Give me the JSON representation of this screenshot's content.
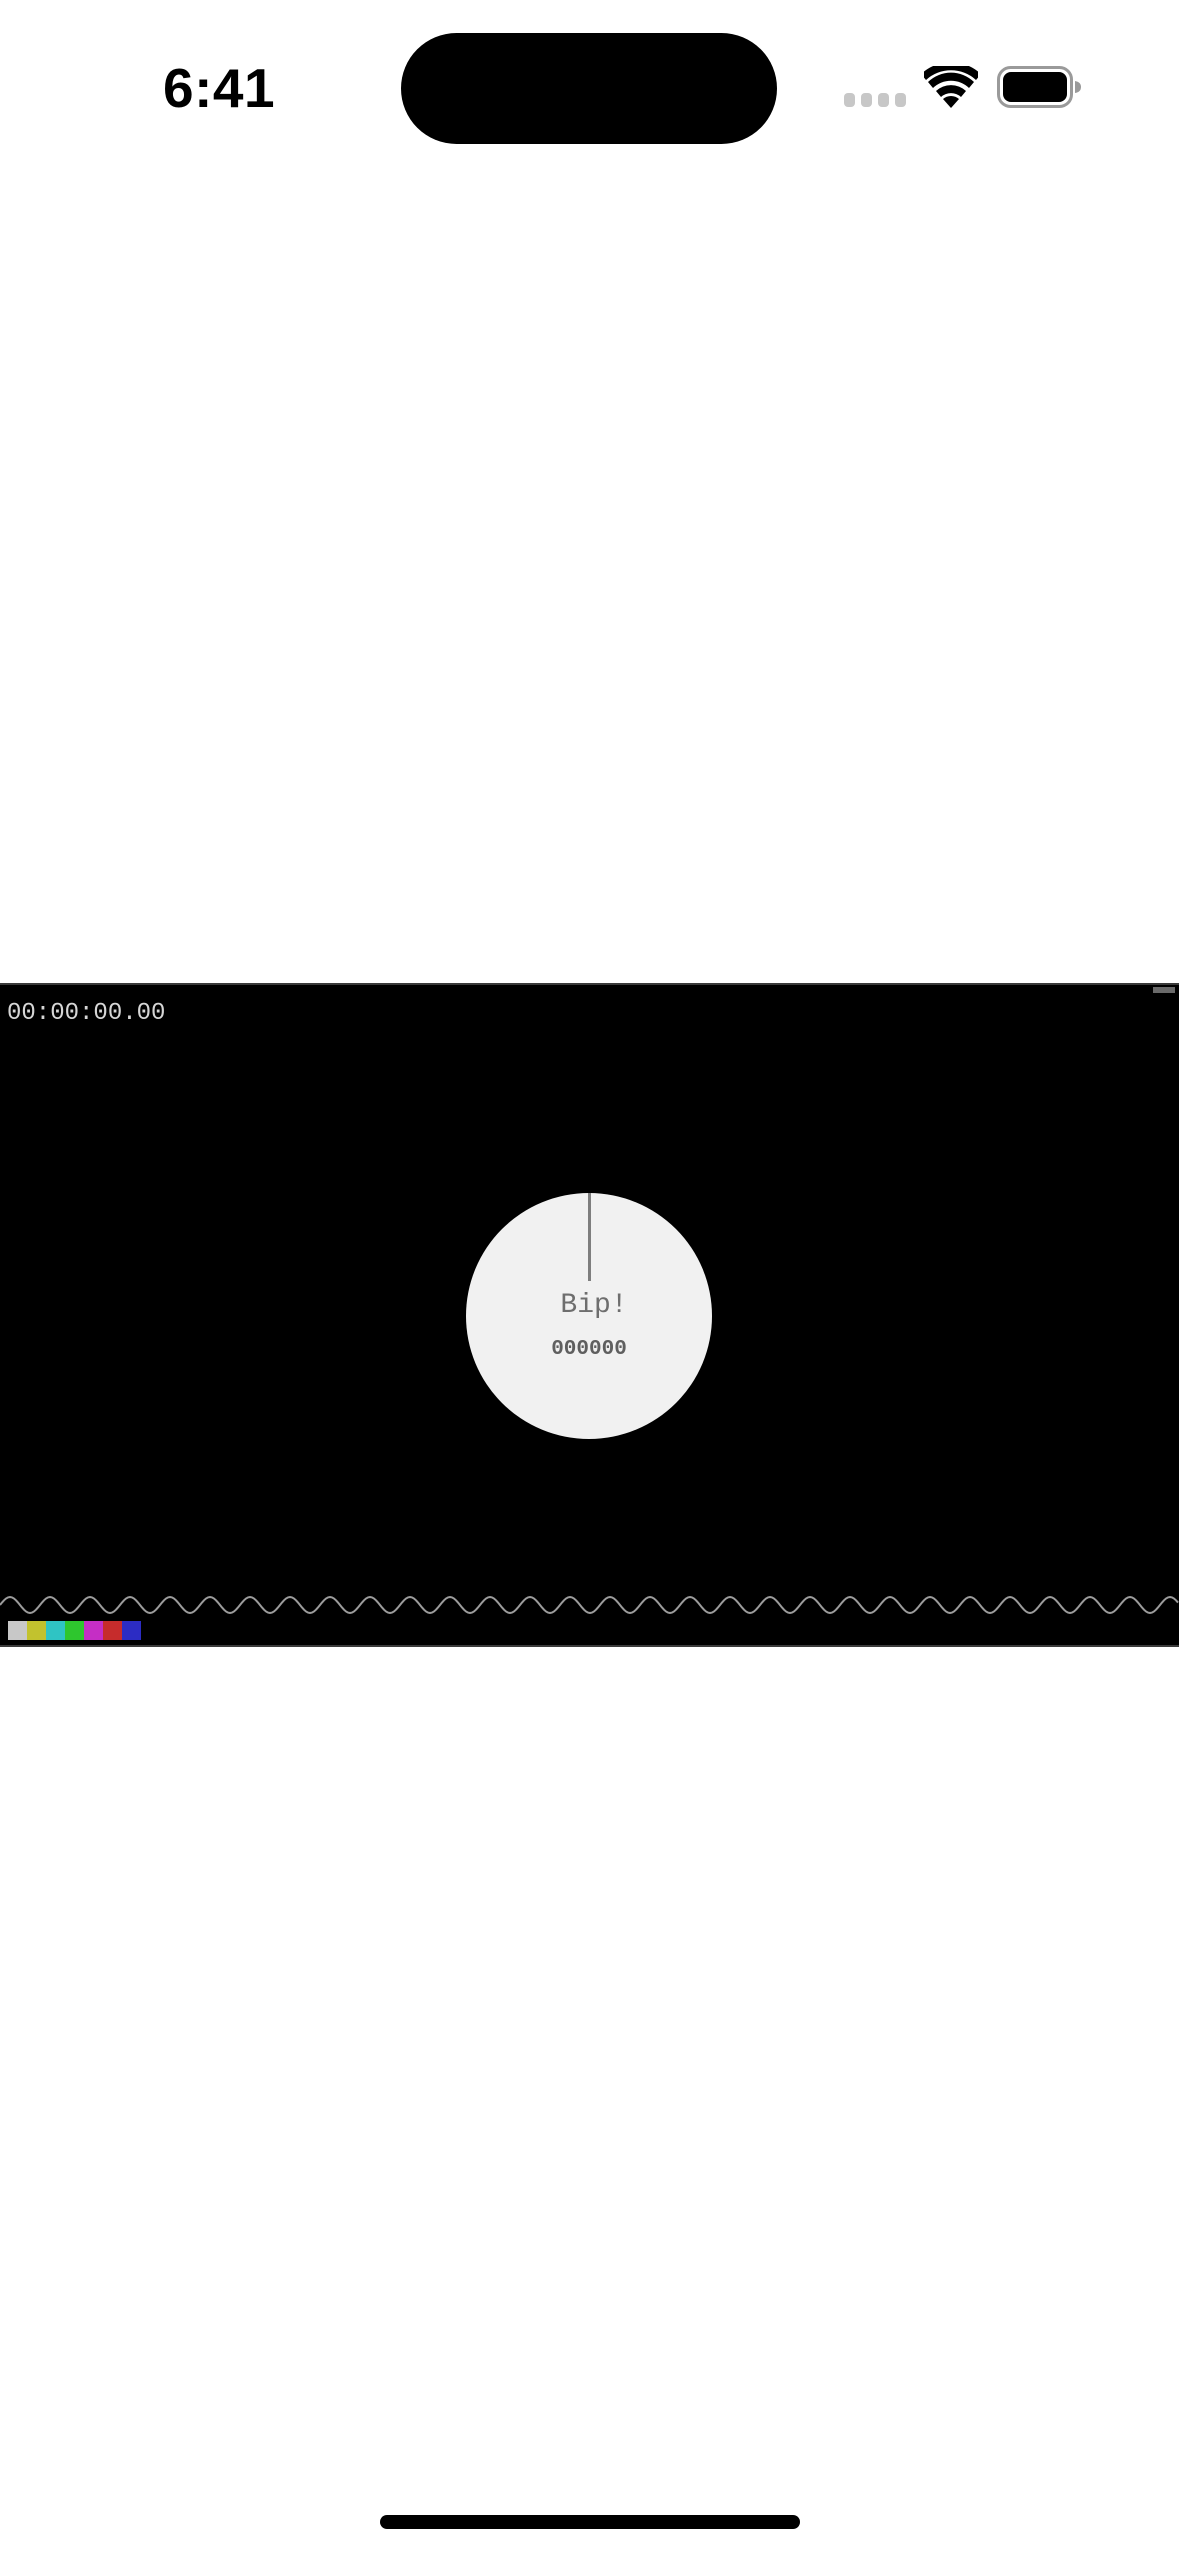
{
  "status_bar": {
    "time": "6:41",
    "icons": [
      "cellular-signal-icon",
      "wifi-icon",
      "battery-icon"
    ],
    "signal_bars_active": 0,
    "battery_level": 1.0
  },
  "player": {
    "timecode": "00:00:00.00",
    "beep_label": "Bip!",
    "frame_counter": "000000",
    "background_color": "#000000",
    "clock_face_color": "#f1f1f1",
    "color_bars": [
      "#c8c8c8",
      "#c2c22e",
      "#2fc4c4",
      "#2ec62e",
      "#c52ec5",
      "#c62c2c",
      "#2c2cc4"
    ]
  }
}
